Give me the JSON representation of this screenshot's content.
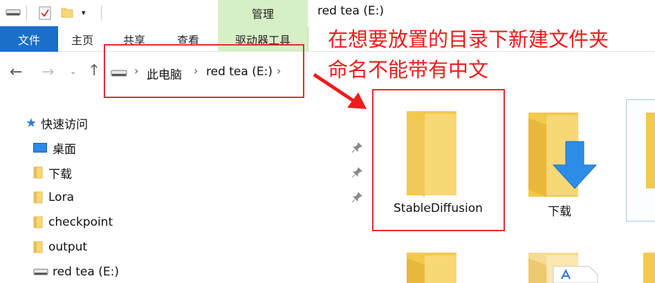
{
  "window": {
    "title": "red tea (E:)"
  },
  "ribbon": {
    "context_tab": "管理",
    "tabs": {
      "file": "文件",
      "home": "主页",
      "share": "共享",
      "view": "查看",
      "drive_tools": "驱动器工具"
    }
  },
  "address": {
    "crumbs": [
      "此电脑",
      "red tea (E:)"
    ]
  },
  "sidebar": {
    "quick_access": "快速访问",
    "items": [
      {
        "label": "桌面",
        "icon": "desktop-icon",
        "pinned": true
      },
      {
        "label": "下载",
        "icon": "folder-icon",
        "pinned": true
      },
      {
        "label": "Lora",
        "icon": "folder-icon",
        "pinned": true
      },
      {
        "label": "checkpoint",
        "icon": "folder-icon",
        "pinned": false
      },
      {
        "label": "output",
        "icon": "folder-icon",
        "pinned": false
      },
      {
        "label": "red tea (E:)",
        "icon": "drive-icon",
        "pinned": false
      }
    ]
  },
  "annotation": {
    "line1": "在想要放置的目录下新建文件夹",
    "line2": "命名不能带有中文",
    "color": "#ee1c1c"
  },
  "content": {
    "items": [
      {
        "label": "StableDiffusion",
        "icon": "folder-icon",
        "highlighted": true
      },
      {
        "label": "下载",
        "icon": "downloads-folder-icon",
        "highlighted": false
      }
    ]
  },
  "colors": {
    "file_tab": "#1a6fc9",
    "context_tab": "#d7efc7",
    "highlight": "#e22b2b",
    "folder": "#f8d775"
  }
}
